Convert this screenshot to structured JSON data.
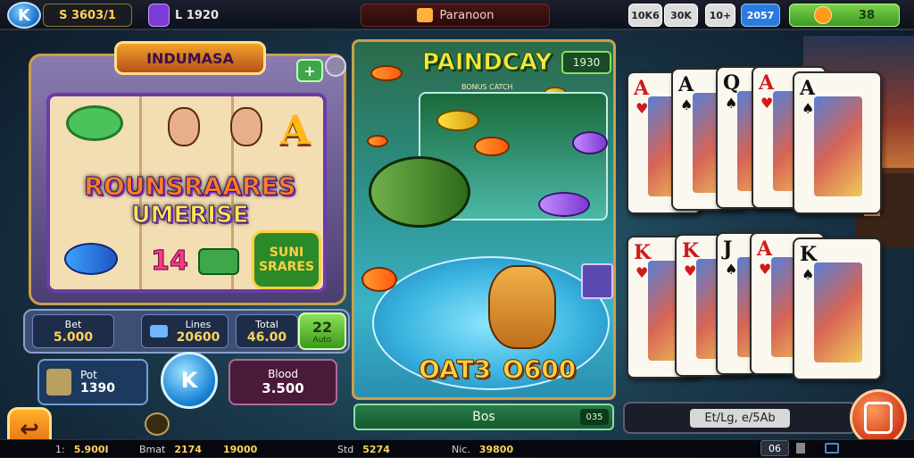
{
  "topbar": {
    "logo": "K",
    "coins": "S 3603/1",
    "level": "L 1920",
    "center_label": "Paranoon",
    "chip1": "10K6",
    "chip2": "30K",
    "chip3": "10+",
    "chip4": "2057",
    "gem_value": "38"
  },
  "slot": {
    "title": "INDUMASA",
    "plus": "+",
    "line1": "ROUNSRAARES",
    "line2": "UMERISE",
    "number": "14",
    "badge": "SUNI SRARES",
    "bet1_label": "Bet",
    "bet1_value": "5.000",
    "bet2_label": "Lines",
    "bet2_value": "20600",
    "bet3_label": "Total",
    "bet3_value": "46.00",
    "bet_btn": "22",
    "bet_btn_sub": "Auto",
    "win_label": "Pot",
    "win_value": "1390",
    "spin": "K",
    "balance_label": "Blood",
    "balance_value": "3.500"
  },
  "fish": {
    "title": "PAINDCAY",
    "subtitle": "BONUS CATCH",
    "counter": "1930",
    "score1": "OAT3",
    "score2": "O600",
    "button": "Bos",
    "button_count": "035"
  },
  "cards": {
    "top": [
      {
        "rank": "A",
        "suit": "♥",
        "color": "red"
      },
      {
        "rank": "A",
        "suit": "♠",
        "color": "blk"
      },
      {
        "rank": "Q",
        "suit": "♠",
        "color": "blk"
      },
      {
        "rank": "A",
        "suit": "♥",
        "color": "red"
      },
      {
        "rank": "A",
        "suit": "♠",
        "color": "blk"
      }
    ],
    "bottom": [
      {
        "rank": "K",
        "suit": "♥",
        "color": "red"
      },
      {
        "rank": "K",
        "suit": "♥",
        "color": "red"
      },
      {
        "rank": "J",
        "suit": "♠",
        "color": "blk"
      },
      {
        "rank": "A",
        "suit": "♥",
        "color": "red"
      },
      {
        "rank": "K",
        "suit": "♠",
        "color": "blk"
      }
    ],
    "bar_label": "Et/Lg, e/5Ab"
  },
  "bottombar": {
    "s1_label": "1:",
    "s1_value": "5.900I",
    "s2_label": "Bmat",
    "s2_value": "2174",
    "s3_label": "",
    "s3_value": "19000",
    "s4_label": "Std",
    "s4_value": "5274",
    "s5_label": "Nic.",
    "s5_value": "39800",
    "num": "06"
  },
  "back_glyph": "↩",
  "colors": {
    "accent_gold": "#c8a04a",
    "accent_green": "#3d9a22",
    "accent_blue": "#2a7ae0"
  }
}
